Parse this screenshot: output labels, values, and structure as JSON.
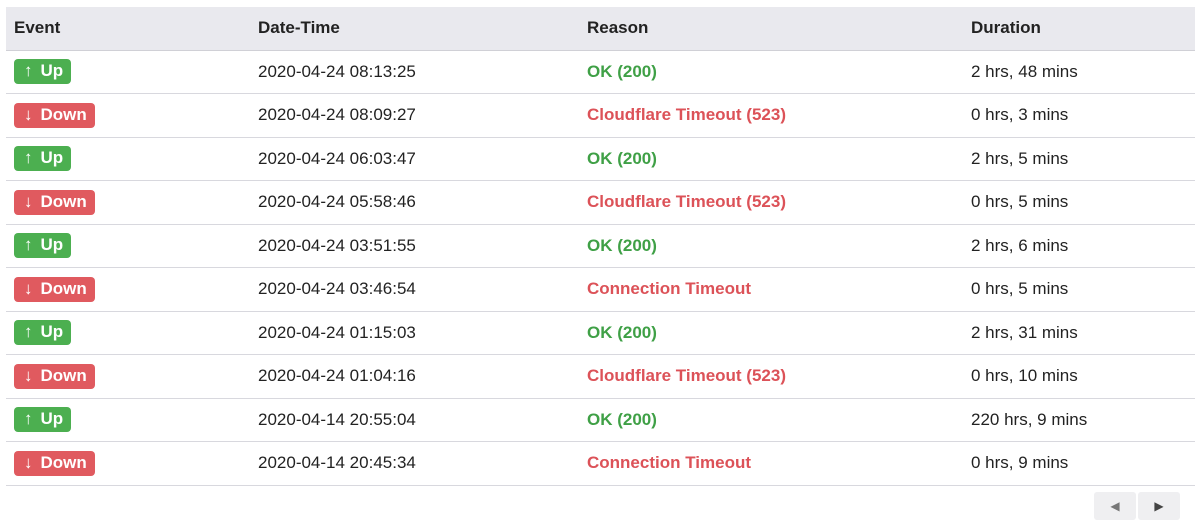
{
  "table": {
    "headers": [
      "Event",
      "Date-Time",
      "Reason",
      "Duration"
    ],
    "rows": [
      {
        "event": "Up",
        "arrow": "↑",
        "type": "up",
        "datetime": "2020-04-24 08:13:25",
        "reason": "OK (200)",
        "duration": "2 hrs, 48 mins"
      },
      {
        "event": "Down",
        "arrow": "↓",
        "type": "down",
        "datetime": "2020-04-24 08:09:27",
        "reason": "Cloudflare Timeout (523)",
        "duration": "0 hrs, 3 mins"
      },
      {
        "event": "Up",
        "arrow": "↑",
        "type": "up",
        "datetime": "2020-04-24 06:03:47",
        "reason": "OK (200)",
        "duration": "2 hrs, 5 mins"
      },
      {
        "event": "Down",
        "arrow": "↓",
        "type": "down",
        "datetime": "2020-04-24 05:58:46",
        "reason": "Cloudflare Timeout (523)",
        "duration": "0 hrs, 5 mins"
      },
      {
        "event": "Up",
        "arrow": "↑",
        "type": "up",
        "datetime": "2020-04-24 03:51:55",
        "reason": "OK (200)",
        "duration": "2 hrs, 6 mins"
      },
      {
        "event": "Down",
        "arrow": "↓",
        "type": "down",
        "datetime": "2020-04-24 03:46:54",
        "reason": "Connection Timeout",
        "duration": "0 hrs, 5 mins"
      },
      {
        "event": "Up",
        "arrow": "↑",
        "type": "up",
        "datetime": "2020-04-24 01:15:03",
        "reason": "OK (200)",
        "duration": "2 hrs, 31 mins"
      },
      {
        "event": "Down",
        "arrow": "↓",
        "type": "down",
        "datetime": "2020-04-24 01:04:16",
        "reason": "Cloudflare Timeout (523)",
        "duration": "0 hrs, 10 mins"
      },
      {
        "event": "Up",
        "arrow": "↑",
        "type": "up",
        "datetime": "2020-04-14 20:55:04",
        "reason": "OK (200)",
        "duration": "220 hrs, 9 mins"
      },
      {
        "event": "Down",
        "arrow": "↓",
        "type": "down",
        "datetime": "2020-04-14 20:45:34",
        "reason": "Connection Timeout",
        "duration": "0 hrs, 9 mins"
      }
    ]
  },
  "pagination": {
    "prev_icon": "◀",
    "next_icon": "▶"
  },
  "colors": {
    "up": "#4caf50",
    "down": "#e05a5f"
  }
}
